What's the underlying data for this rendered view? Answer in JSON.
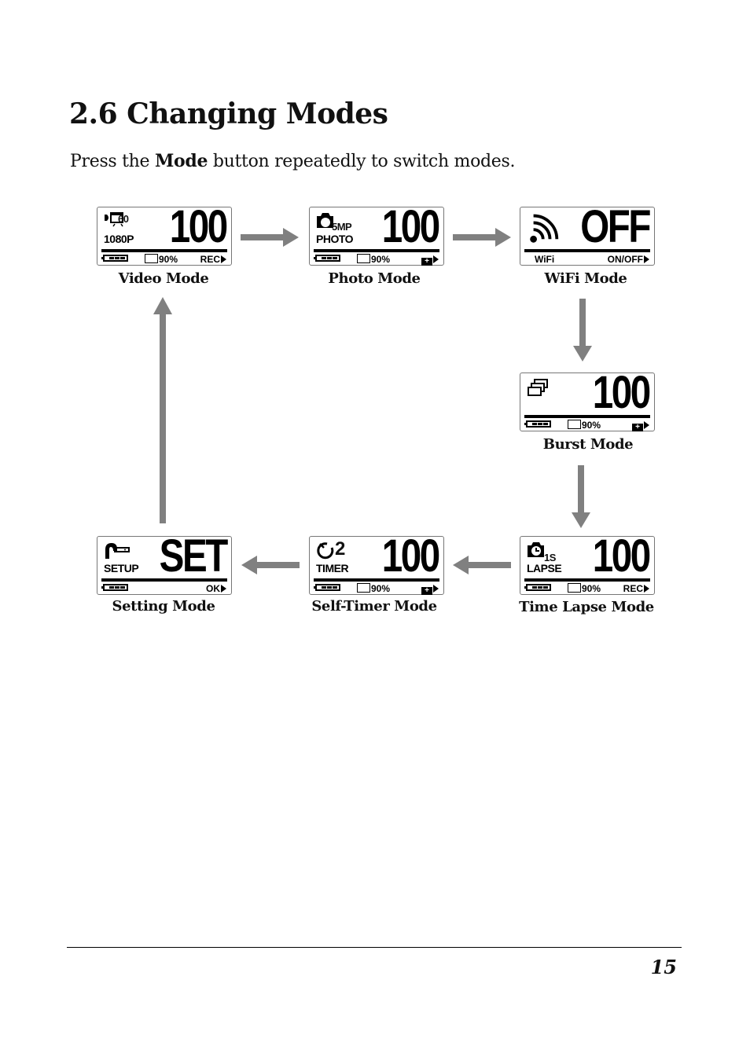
{
  "section": {
    "title": "2.6 Changing Modes",
    "intro_before": "Press the ",
    "intro_bold": "Mode",
    "intro_after": " button repeatedly to switch modes."
  },
  "modes": [
    {
      "id": "video",
      "caption": "Video Mode",
      "icon": "video-camera-icon",
      "icon_label_top": "60",
      "sub_label": "1080P",
      "big_value": "100",
      "storage": "90%",
      "action": "REC",
      "battery_bars": 3
    },
    {
      "id": "photo",
      "caption": "Photo Mode",
      "icon": "photo-camera-icon",
      "icon_label_top": "5MP",
      "sub_label": "PHOTO",
      "big_value": "100",
      "storage": "90%",
      "action": "+",
      "battery_bars": 3
    },
    {
      "id": "wifi",
      "caption": "WiFi Mode",
      "icon": "wifi-icon",
      "sub_label": "WiFi",
      "big_value": "OFF",
      "action": "ON/OFF"
    },
    {
      "id": "burst",
      "caption": "Burst Mode",
      "icon": "burst-stack-icon",
      "big_value": "100",
      "storage": "90%",
      "action": "+",
      "battery_bars": 3
    },
    {
      "id": "timelapse",
      "caption": "Time Lapse Mode",
      "icon": "timelapse-camera-icon",
      "icon_label_top": "1S",
      "sub_label": "LAPSE",
      "big_value": "100",
      "storage": "90%",
      "action": "REC",
      "battery_bars": 3
    },
    {
      "id": "selftimer",
      "caption": "Self-Timer Mode",
      "icon": "timer-icon",
      "icon_label_top": "2",
      "sub_label": "TIMER",
      "big_value": "100",
      "storage": "90%",
      "action": "+",
      "battery_bars": 3
    },
    {
      "id": "setting",
      "caption": "Setting Mode",
      "icon": "wrench-icon",
      "sub_label": "SETUP",
      "big_value": "SET",
      "action": "OK",
      "battery_bars": 3
    }
  ],
  "flow": [
    "Video Mode",
    "Photo Mode",
    "WiFi Mode",
    "Burst Mode",
    "Time Lapse Mode",
    "Self-Timer Mode",
    "Setting Mode",
    "Video Mode"
  ],
  "colors": {
    "arrow": "#808080",
    "text": "#111111",
    "lcd_border": "#777777"
  },
  "footer": {
    "page_number": "15"
  }
}
